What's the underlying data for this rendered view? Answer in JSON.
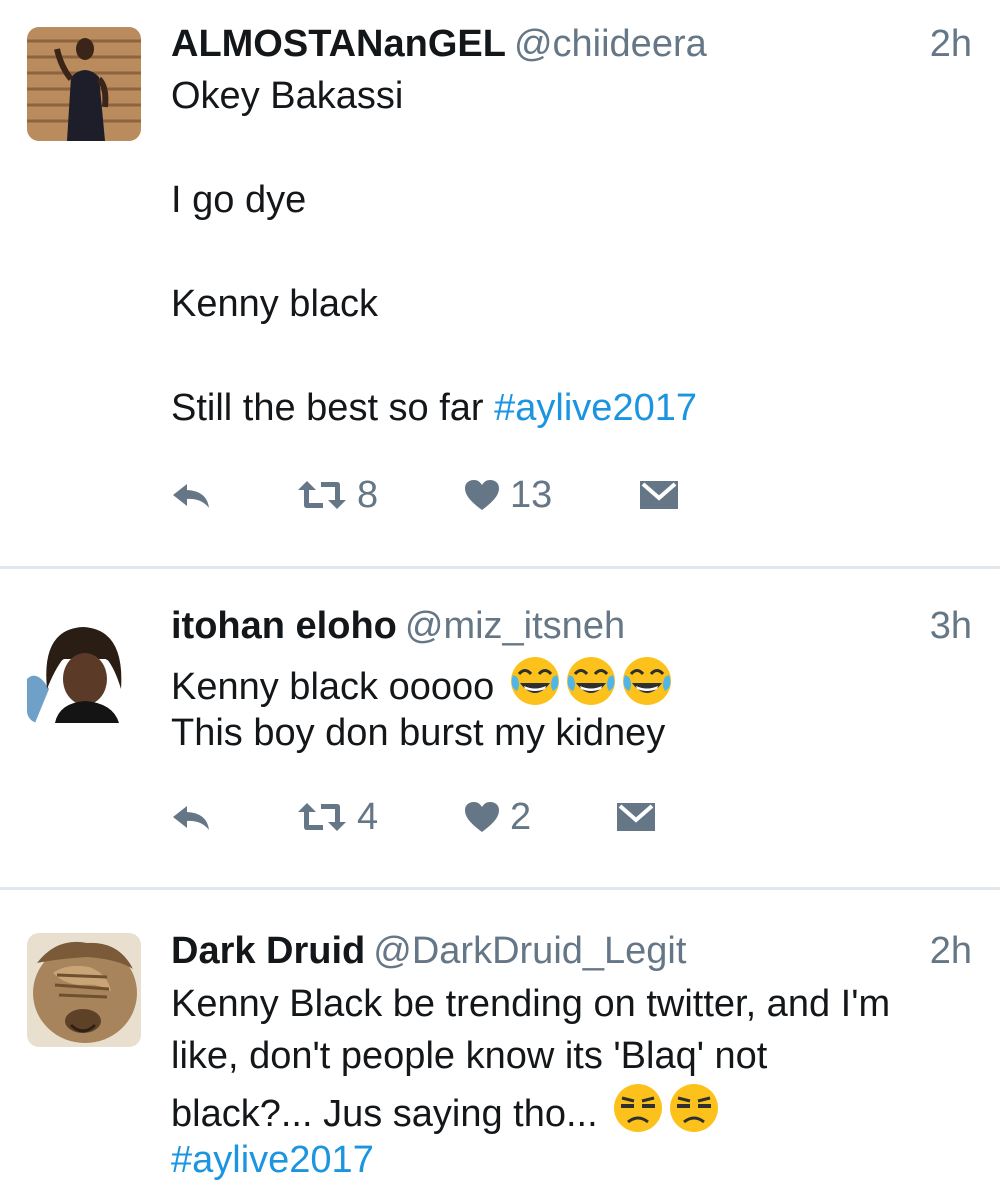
{
  "tweets": [
    {
      "name": "ALMOSTANanGEL",
      "handle": "@chiideera",
      "time": "2h",
      "lines": [
        "Okey Bakassi",
        "",
        "I go dye",
        "",
        "Kenny black",
        "",
        "Still the best so far"
      ],
      "hashtag": "#aylive2017",
      "retweets": "8",
      "likes": "13"
    },
    {
      "name": "itohan eloho",
      "handle": "@miz_itsneh",
      "time": "3h",
      "lines": [
        "Kenny black ooooo",
        "This boy don burst my kidney"
      ],
      "retweets": "4",
      "likes": "2"
    },
    {
      "name": "Dark Druid",
      "handle": "@DarkDruid_Legit",
      "time": "2h",
      "lines": [
        "Kenny Black be trending on twitter, and I'm",
        "like, don't people know its 'Blaq' not",
        "black?... Jus saying tho..."
      ],
      "hashtag": "#aylive2017"
    }
  ],
  "icons": {
    "reply": "reply-icon",
    "retweet": "retweet-icon",
    "like": "heart-icon",
    "dm": "envelope-icon",
    "laugh": "tears-of-joy-emoji",
    "unamused": "unamused-emoji"
  },
  "colors": {
    "hashtag": "#1b95e0",
    "secondary": "#657786",
    "divider": "#e1e8ed",
    "text": "#14171a"
  }
}
